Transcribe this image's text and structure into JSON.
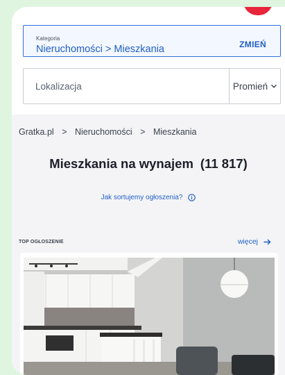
{
  "category": {
    "label": "Kategoria",
    "value": "Nieruchomości > Mieszkania",
    "change_label": "ZMIEŃ"
  },
  "location": {
    "placeholder": "Lokalizacja",
    "radius_label": "Promień"
  },
  "breadcrumb": [
    "Gratka.pl",
    "Nieruchomości",
    "Mieszkania"
  ],
  "heading": {
    "title": "Mieszkania na wynajem",
    "count": "(11 817)"
  },
  "sort_info": "Jak sortujemy ogłoszenia?",
  "top_listings": {
    "label": "TOP OGŁOSZENIE",
    "more_label": "więcej"
  },
  "colors": {
    "accent": "#1f5fc5",
    "brand_red": "#e8253a",
    "background": "#dff5df"
  }
}
